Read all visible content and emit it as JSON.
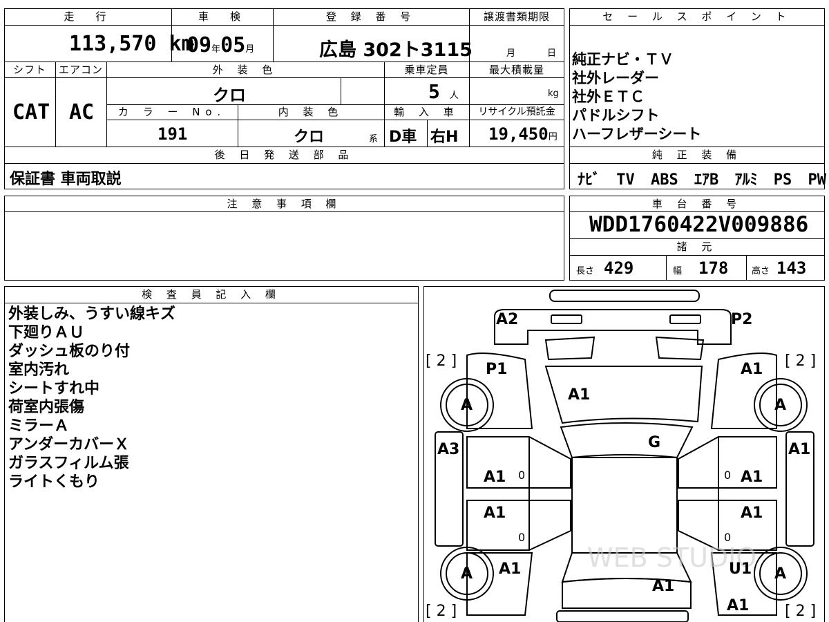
{
  "top": {
    "mileage_header": "走　行",
    "mileage_value": "113,570",
    "mileage_unit": "km",
    "inspection_header": "車　検",
    "inspection_year": "09",
    "inspection_year_unit": "年",
    "inspection_month": "05",
    "inspection_month_unit": "月",
    "registration_header": "登 録 番 号",
    "registration_value": "広島 302ト3115",
    "transfer_header": "譲渡書類期限",
    "transfer_month": "月",
    "transfer_day": "日"
  },
  "row2": {
    "shift_header": "シフト",
    "ac_header": "エアコン",
    "exterior_header": "外 装 色",
    "capacity_header": "乗車定員",
    "maxload_header": "最大積載量",
    "shift_value": "CAT",
    "ac_value": "AC",
    "exterior_value": "クロ",
    "capacity_value": "5",
    "capacity_unit": "人",
    "maxload_unit": "kg",
    "color_no_header": "カ ラ ー No.",
    "interior_header": "内 装 色",
    "import_header": "輸 入 車",
    "recycle_header": "リサイクル預託金",
    "color_no_value": "191",
    "interior_value": "クロ",
    "interior_suffix": "系",
    "import_value1": "D車",
    "import_value2": "右H",
    "recycle_value": "19,450",
    "recycle_unit": "円"
  },
  "later_parts": {
    "header": "後 日 発 送 部 品",
    "value": "保証書 車両取説"
  },
  "sales_points": {
    "header": "セ ー ル ス ポ イ ン ト",
    "items": [
      "純正ナビ・ＴＶ",
      "社外レーダー",
      "社外ＥＴＣ",
      "パドルシフト",
      "ハーフレザーシート"
    ]
  },
  "genuine_equipment": {
    "header": "純 正 装 備",
    "items": [
      "ﾅﾋﾞ",
      "TV",
      "ABS",
      "ｴｱB",
      "ｱﾙﾐ",
      "PS",
      "PW"
    ]
  },
  "notes": {
    "header": "注 意 事 項 欄"
  },
  "chassis": {
    "header": "車 台 番 号",
    "value": "WDD1760422V009886",
    "spec_header": "諸 元",
    "length_label": "長さ",
    "length_value": "429",
    "width_label": "幅",
    "width_value": "178",
    "height_label": "高さ",
    "height_value": "143"
  },
  "inspector": {
    "header": "検 査 員 記 入 欄",
    "remarks": [
      "外装しみ、うすい線キズ",
      "下廻りＡＵ",
      "ダッシュ板のり付",
      "室内汚れ",
      "シートすれ中",
      "荷室内張傷",
      "ミラーＡ",
      "アンダーカバーＸ",
      "ガラスフィルム張",
      "ライトくもり"
    ]
  },
  "diagram": {
    "labels": {
      "a2": "A2",
      "p2": "P2",
      "p1": "P1",
      "a1_fr": "A1",
      "a1_hood": "A1",
      "g": "G",
      "a3": "A3",
      "a1_r_side": "A1",
      "a1_ld_front": "A1",
      "a1_rd_front": "A1",
      "a1_ld_rear": "A1",
      "a1_rd_rear": "A1",
      "a1_lr": "A1",
      "u1": "U1",
      "a1_trunk": "A1",
      "a1_rr": "A1",
      "zero1": "0",
      "zero2": "0",
      "zero3": "0",
      "zero4": "0",
      "tire_fl": "A",
      "tire_fr": "A",
      "tire_rl": "A",
      "tire_rr": "A",
      "bracket_fl": "[ 2 ]",
      "bracket_fr": "[ 2 ]",
      "bracket_rl": "[ 2 ]",
      "bracket_rr": "[ 2 ]"
    },
    "watermark": "WEB STUDIO"
  }
}
